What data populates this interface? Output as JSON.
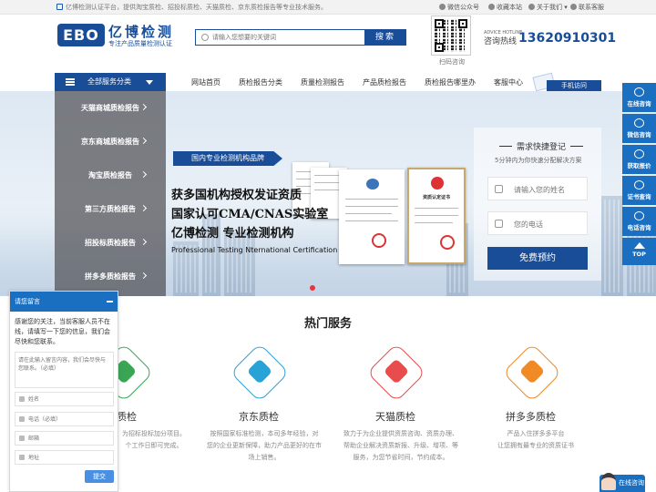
{
  "topbar": {
    "notice": "亿博检测认证平台，提供淘宝质检、招投标质检、天猫质检、京东质检报告等专业技术服务。",
    "links": [
      "微信公众号",
      "收藏本站",
      "关于我们",
      "联系客服"
    ]
  },
  "header": {
    "logo": "EBO",
    "brand": "亿博检测",
    "slogan": "专注产品质量检测认证",
    "search_placeholder": "请输入您想要的关键词",
    "search_button": "搜索",
    "qr_caption": "扫码咨询",
    "hotline_en": "ADVICE HOTLINE",
    "hotline_label": "咨询热线",
    "hotline_number": "13620910301"
  },
  "nav": {
    "category": "全部服务分类",
    "items": [
      "网站首页",
      "质检报告分类",
      "质量检测报告",
      "产品质检报告",
      "质检报告哪里办",
      "客服中心"
    ],
    "phone_visit": "手机访问"
  },
  "sidemenu": [
    "天猫商城质检报告",
    "京东商城质检报告",
    "淘宝质检报告",
    "第三方质检报告",
    "招投标质检报告",
    "拼多多质检报告"
  ],
  "banner": {
    "tag": "国内专业检测机构品牌",
    "line1": "获多国机构授权发证资质",
    "line2": "国家认可CMA/CNAS实验室",
    "line3": "亿博检测  专业检测机构",
    "english": "Professional Testing Nternational Certification",
    "cert_titles": [
      "资质认定证书"
    ]
  },
  "register": {
    "title": "需求快捷登记",
    "subtitle": "5分钟内为你快速分配解决方案",
    "name_placeholder": "请输入您的姓名",
    "phone_placeholder": "您的电话",
    "button": "免费预约"
  },
  "rightbar": [
    "在线咨询",
    "微信咨询",
    "获取报价",
    "证书查询",
    "电话咨询",
    "TOP"
  ],
  "services": {
    "title": "热门服务",
    "items": [
      {
        "name": "标质检",
        "desc": [
          "为招标投标加分项目。",
          "个工作日即可完成。"
        ],
        "color": "#3aa655"
      },
      {
        "name": "京东质检",
        "desc": [
          "按照国家标准检测，本司多年经验，对",
          "您的企业更新保障，助力产品更好的在市",
          "场上销售。"
        ],
        "color": "#29a3d6"
      },
      {
        "name": "天猫质检",
        "desc": [
          "致力于为企业提供资质咨询、资质办理、",
          "帮助企业解决资质新报、升级、增项、等",
          "服务，为您节省时间，节约成本。"
        ],
        "color": "#e84c4c"
      },
      {
        "name": "拼多多质检",
        "desc": [
          "严品入住拼多多平台",
          "让您拥有最专业的资质证书"
        ],
        "color": "#f08a24"
      }
    ]
  },
  "chat": {
    "header": "请您留言",
    "message": "感谢您的关注，当前客服人员不在线，请填写一下您的信息，我们会尽快和您联系。",
    "textarea_placeholder": "请在此输入留言内容，我们会尽快与您联系。（必填）",
    "fields": [
      "姓名",
      "电话（必填）",
      "邮箱",
      "地址"
    ],
    "submit": "提交"
  },
  "online_button": "在线咨询",
  "colors": {
    "brand": "#1a4d97",
    "side_blue": "#1a6fc1"
  }
}
